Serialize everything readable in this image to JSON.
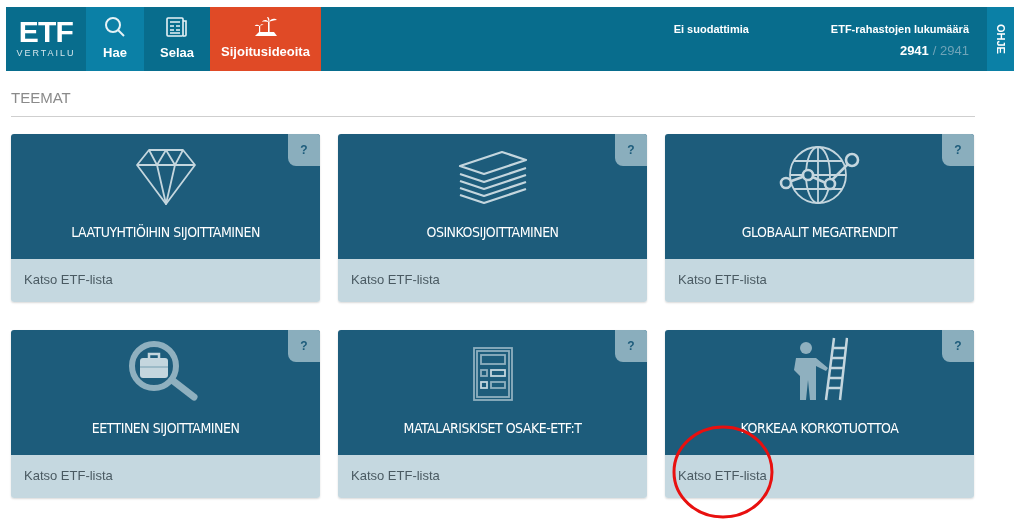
{
  "logo": {
    "title": "ETF",
    "subtitle": "VERTAILU"
  },
  "nav": [
    {
      "label": "Hae",
      "kind": "search",
      "selected": false
    },
    {
      "label": "Selaa",
      "kind": "browse",
      "selected": false
    },
    {
      "label": "Sijoitusideoita",
      "kind": "ideas",
      "selected": true
    }
  ],
  "filter_status": "Ei suodattimia",
  "fund_count": {
    "label": "ETF-rahastojen lukumäärä",
    "shown": "2941",
    "separator": "/",
    "total": "2941"
  },
  "help_tab": "OHJE",
  "section_title": "TEEMAT",
  "themes": [
    {
      "kind": "diamond",
      "title": "LAATUYHTIÖIHIN SIJOITTAMINEN",
      "help": "?",
      "link": "Katso ETF-lista"
    },
    {
      "kind": "papers",
      "title": "OSINKOSIJOITTAMINEN",
      "help": "?",
      "link": "Katso ETF-lista"
    },
    {
      "kind": "globe",
      "title": "GLOBAALIT MEGATRENDIT",
      "help": "?",
      "link": "Katso ETF-lista"
    },
    {
      "kind": "magnifier",
      "title": "EETTINEN SIJOITTAMINEN",
      "help": "?",
      "link": "Katso ETF-lista"
    },
    {
      "kind": "calculator",
      "title": "MATALARISKISET OSAKE-ETF:T",
      "help": "?",
      "link": "Katso ETF-lista"
    },
    {
      "kind": "ladder",
      "title": "KORKEAA KORKOTUOTTOA",
      "help": "?",
      "link": "Katso ETF-lista",
      "highlighted": true
    }
  ]
}
